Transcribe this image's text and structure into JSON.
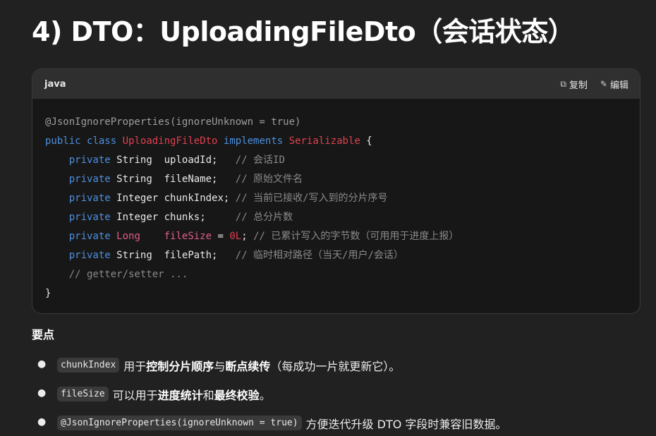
{
  "heading": "4) DTO：UploadingFileDto（会话状态）",
  "code_block": {
    "language": "java",
    "copy_label": "复制",
    "edit_label": "编辑",
    "lines": {
      "l1": "@JsonIgnoreProperties(ignoreUnknown = true)",
      "l2_kw1": "public",
      "l2_kw2": "class",
      "l2_cls": "UploadingFileDto",
      "l2_kw3": "implements",
      "l2_iface": "Serializable",
      "l2_brace": "{",
      "private": "private",
      "f1_type": "String",
      "f1_name": "uploadId;",
      "f1_cmt": "// 会话ID",
      "f2_type": "String",
      "f2_name": "fileName;",
      "f2_cmt": "// 原始文件名",
      "f3_type": "Integer",
      "f3_name": "chunkIndex;",
      "f3_cmt": "// 当前已接收/写入到的分片序号",
      "f4_type": "Integer",
      "f4_name": "chunks;",
      "f4_cmt": "// 总分片数",
      "f5_type": "Long",
      "f5_name": "fileSize",
      "f5_eq": "=",
      "f5_val": "0L",
      "f5_semi": ";",
      "f5_cmt": "// 已累计写入的字节数（可用用于进度上报）",
      "f6_type": "String",
      "f6_name": "filePath;",
      "f6_cmt": "// 临时相对路径（当天/用户/会话）",
      "getter_cmt": "// getter/setter ...",
      "close": "}"
    }
  },
  "section_title": "要点",
  "bullets": [
    {
      "code": "chunkIndex",
      "t1": "用于",
      "b1": "控制分片顺序",
      "t2": "与",
      "b2": "断点续传",
      "t3": "（每成功一片就更新它）。"
    },
    {
      "code": "fileSize",
      "t1": "可以用于",
      "b1": "进度统计",
      "t2": "和",
      "b2": "最终校验",
      "t3": "。"
    },
    {
      "code": "@JsonIgnoreProperties(ignoreUnknown = true)",
      "t1": "方便迭代升级 DTO 字段时兼容旧数据。"
    }
  ],
  "icons": {
    "copy": "copy-icon",
    "edit": "pencil-icon"
  }
}
